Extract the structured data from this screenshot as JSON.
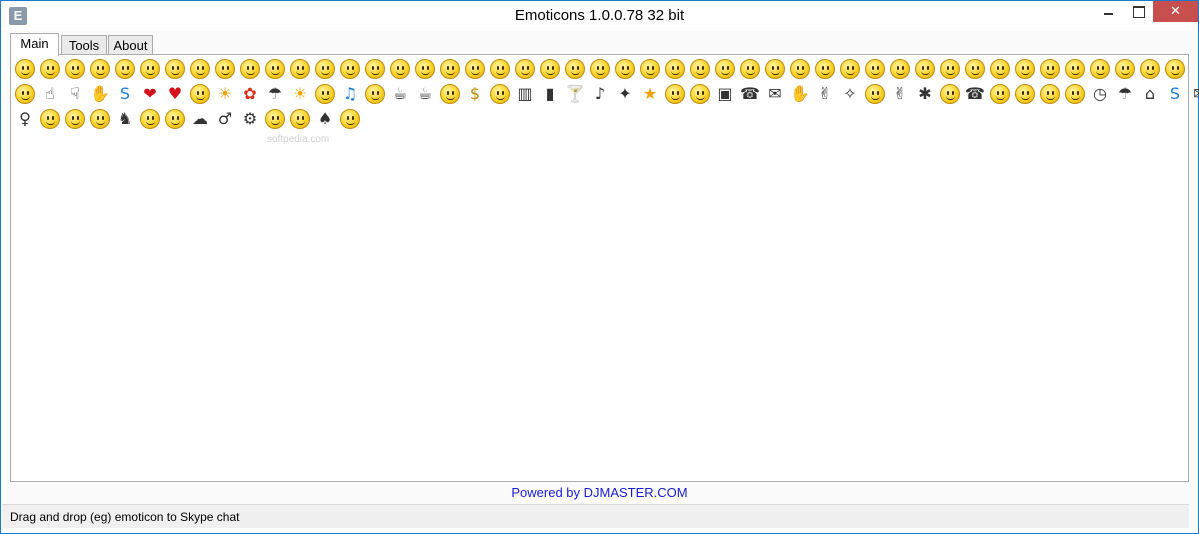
{
  "window": {
    "title": "Emoticons 1.0.0.78 32 bit",
    "app_icon_letter": "E",
    "close_glyph": "✕"
  },
  "tabs": [
    {
      "label": "Main",
      "active": true
    },
    {
      "label": "Tools",
      "active": false
    },
    {
      "label": "About",
      "active": false
    }
  ],
  "watermark": "softpedia.com",
  "footer": {
    "powered_by": "Powered by DJMASTER.COM"
  },
  "status": {
    "text": "Drag and drop (eg) emoticon to Skype chat"
  },
  "emoticons": {
    "row1": [
      "smile",
      "sad",
      "laugh",
      "cool",
      "surprised",
      "wink",
      "cry",
      "sweat",
      "speechless",
      "kiss",
      "tongue",
      "blush",
      "wonder",
      "sleepy",
      "dull",
      "inlove",
      "grin",
      "talk",
      "yawn",
      "puke",
      "doh",
      "angry",
      "wasntme",
      "party",
      "worried",
      "mmm",
      "nerd",
      "lipssealed",
      "hi",
      "call",
      "devil",
      "angel",
      "envy",
      "wait",
      "bear",
      "makeup",
      "giggle",
      "clap",
      "think",
      "bow",
      "rofl",
      "whew",
      "happy",
      "smirk",
      "nod",
      "shake",
      "punch"
    ],
    "row2": [
      "emo",
      "yes",
      "no",
      "handshake",
      "skype",
      "heart",
      "brokenheart",
      "monkey",
      "sunny",
      "flower",
      "rain",
      "sun",
      "bow2",
      "music",
      "ninja",
      "coffee",
      "mug",
      "pizza",
      "cash",
      "muscle",
      "cake",
      "beer",
      "drink",
      "dance",
      "kungfu",
      "star",
      "mooning",
      "time",
      "movie",
      "phone",
      "mail",
      "hug",
      "rock",
      "idea",
      "drunk",
      "fingers",
      "bug",
      "toivo",
      "phone2",
      "lalala",
      "heidy",
      "broken",
      "speechless2",
      "clock",
      "rain2",
      "home",
      "skype2",
      "mail2",
      "man"
    ],
    "row3": [
      "woman",
      "nerd2",
      "headbang",
      "talk2",
      "dog",
      "captain",
      "wait2",
      "sheep",
      "man2",
      "bike",
      "bandit",
      "oliver",
      "cat",
      "ninja2"
    ]
  }
}
